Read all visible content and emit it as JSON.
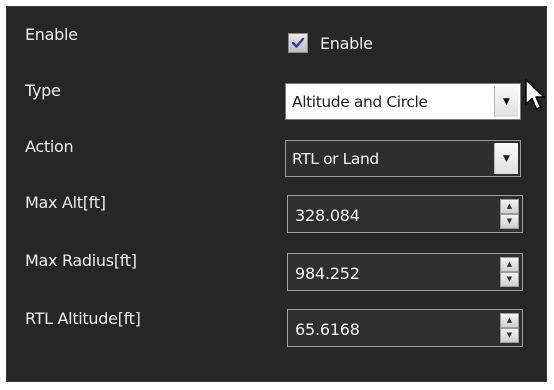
{
  "enable": {
    "label": "Enable",
    "checkbox_label": "Enable",
    "checked": true
  },
  "type": {
    "label": "Type",
    "value": "Altitude and Circle"
  },
  "action": {
    "label": "Action",
    "value": "RTL or Land"
  },
  "max_alt": {
    "label": "Max Alt[ft]",
    "value": "328.084"
  },
  "max_radius": {
    "label": "Max Radius[ft]",
    "value": "984.252"
  },
  "rtl_altitude": {
    "label": "RTL Altitude[ft]",
    "value": "65.6168"
  },
  "icons": {
    "checkbox": "checkmark-icon",
    "dropdown": "chevron-down-icon",
    "spin_up": "spin-up-icon",
    "spin_down": "spin-down-icon",
    "cursor": "mouse-cursor-icon"
  },
  "colors": {
    "panel_bg": "#262626",
    "text": "#ececec",
    "field_bg": "#2f2f2f",
    "field_border": "#a0a0a0"
  }
}
